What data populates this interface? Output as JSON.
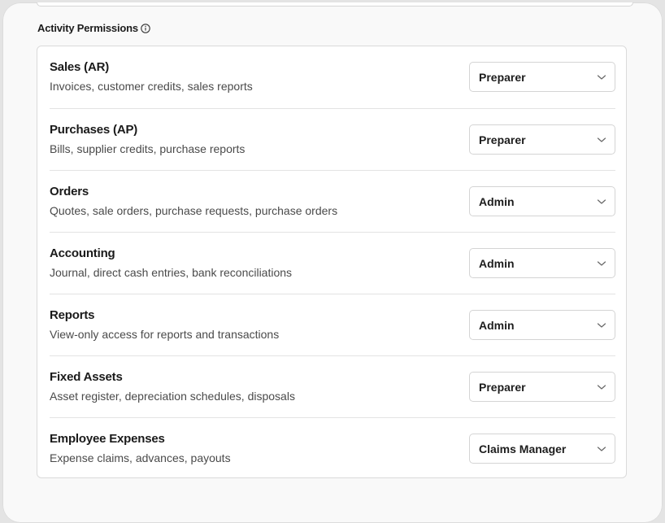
{
  "section": {
    "title": "Activity Permissions"
  },
  "rows": [
    {
      "title": "Sales (AR)",
      "description": "Invoices, customer credits, sales reports",
      "role": "Preparer"
    },
    {
      "title": "Purchases (AP)",
      "description": "Bills, supplier credits, purchase reports",
      "role": "Preparer"
    },
    {
      "title": "Orders",
      "description": "Quotes, sale orders, purchase requests, purchase orders",
      "role": "Admin"
    },
    {
      "title": "Accounting",
      "description": "Journal, direct cash entries, bank reconciliations",
      "role": "Admin"
    },
    {
      "title": "Reports",
      "description": "View-only access for reports and transactions",
      "role": "Admin"
    },
    {
      "title": "Fixed Assets",
      "description": "Asset register, depreciation schedules, disposals",
      "role": "Preparer"
    },
    {
      "title": "Employee Expenses",
      "description": "Expense claims, advances, payouts",
      "role": "Claims Manager"
    }
  ],
  "icons": {
    "info": "info-circle-icon",
    "dropdown": "chevron-down-icon"
  },
  "colors": {
    "text_primary": "#1a1a1a",
    "text_secondary": "#4a4a4a",
    "border": "#dadada"
  }
}
